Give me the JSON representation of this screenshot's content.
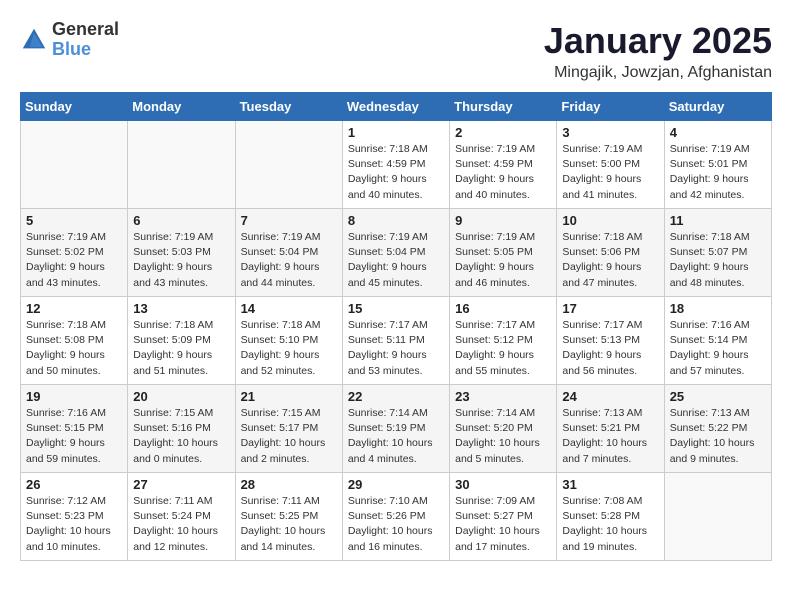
{
  "logo": {
    "general": "General",
    "blue": "Blue"
  },
  "title": "January 2025",
  "subtitle": "Mingajik, Jowzjan, Afghanistan",
  "weekdays": [
    "Sunday",
    "Monday",
    "Tuesday",
    "Wednesday",
    "Thursday",
    "Friday",
    "Saturday"
  ],
  "weeks": [
    [
      {
        "day": "",
        "info": ""
      },
      {
        "day": "",
        "info": ""
      },
      {
        "day": "",
        "info": ""
      },
      {
        "day": "1",
        "info": "Sunrise: 7:18 AM\nSunset: 4:59 PM\nDaylight: 9 hours\nand 40 minutes."
      },
      {
        "day": "2",
        "info": "Sunrise: 7:19 AM\nSunset: 4:59 PM\nDaylight: 9 hours\nand 40 minutes."
      },
      {
        "day": "3",
        "info": "Sunrise: 7:19 AM\nSunset: 5:00 PM\nDaylight: 9 hours\nand 41 minutes."
      },
      {
        "day": "4",
        "info": "Sunrise: 7:19 AM\nSunset: 5:01 PM\nDaylight: 9 hours\nand 42 minutes."
      }
    ],
    [
      {
        "day": "5",
        "info": "Sunrise: 7:19 AM\nSunset: 5:02 PM\nDaylight: 9 hours\nand 43 minutes."
      },
      {
        "day": "6",
        "info": "Sunrise: 7:19 AM\nSunset: 5:03 PM\nDaylight: 9 hours\nand 43 minutes."
      },
      {
        "day": "7",
        "info": "Sunrise: 7:19 AM\nSunset: 5:04 PM\nDaylight: 9 hours\nand 44 minutes."
      },
      {
        "day": "8",
        "info": "Sunrise: 7:19 AM\nSunset: 5:04 PM\nDaylight: 9 hours\nand 45 minutes."
      },
      {
        "day": "9",
        "info": "Sunrise: 7:19 AM\nSunset: 5:05 PM\nDaylight: 9 hours\nand 46 minutes."
      },
      {
        "day": "10",
        "info": "Sunrise: 7:18 AM\nSunset: 5:06 PM\nDaylight: 9 hours\nand 47 minutes."
      },
      {
        "day": "11",
        "info": "Sunrise: 7:18 AM\nSunset: 5:07 PM\nDaylight: 9 hours\nand 48 minutes."
      }
    ],
    [
      {
        "day": "12",
        "info": "Sunrise: 7:18 AM\nSunset: 5:08 PM\nDaylight: 9 hours\nand 50 minutes."
      },
      {
        "day": "13",
        "info": "Sunrise: 7:18 AM\nSunset: 5:09 PM\nDaylight: 9 hours\nand 51 minutes."
      },
      {
        "day": "14",
        "info": "Sunrise: 7:18 AM\nSunset: 5:10 PM\nDaylight: 9 hours\nand 52 minutes."
      },
      {
        "day": "15",
        "info": "Sunrise: 7:17 AM\nSunset: 5:11 PM\nDaylight: 9 hours\nand 53 minutes."
      },
      {
        "day": "16",
        "info": "Sunrise: 7:17 AM\nSunset: 5:12 PM\nDaylight: 9 hours\nand 55 minutes."
      },
      {
        "day": "17",
        "info": "Sunrise: 7:17 AM\nSunset: 5:13 PM\nDaylight: 9 hours\nand 56 minutes."
      },
      {
        "day": "18",
        "info": "Sunrise: 7:16 AM\nSunset: 5:14 PM\nDaylight: 9 hours\nand 57 minutes."
      }
    ],
    [
      {
        "day": "19",
        "info": "Sunrise: 7:16 AM\nSunset: 5:15 PM\nDaylight: 9 hours\nand 59 minutes."
      },
      {
        "day": "20",
        "info": "Sunrise: 7:15 AM\nSunset: 5:16 PM\nDaylight: 10 hours\nand 0 minutes."
      },
      {
        "day": "21",
        "info": "Sunrise: 7:15 AM\nSunset: 5:17 PM\nDaylight: 10 hours\nand 2 minutes."
      },
      {
        "day": "22",
        "info": "Sunrise: 7:14 AM\nSunset: 5:19 PM\nDaylight: 10 hours\nand 4 minutes."
      },
      {
        "day": "23",
        "info": "Sunrise: 7:14 AM\nSunset: 5:20 PM\nDaylight: 10 hours\nand 5 minutes."
      },
      {
        "day": "24",
        "info": "Sunrise: 7:13 AM\nSunset: 5:21 PM\nDaylight: 10 hours\nand 7 minutes."
      },
      {
        "day": "25",
        "info": "Sunrise: 7:13 AM\nSunset: 5:22 PM\nDaylight: 10 hours\nand 9 minutes."
      }
    ],
    [
      {
        "day": "26",
        "info": "Sunrise: 7:12 AM\nSunset: 5:23 PM\nDaylight: 10 hours\nand 10 minutes."
      },
      {
        "day": "27",
        "info": "Sunrise: 7:11 AM\nSunset: 5:24 PM\nDaylight: 10 hours\nand 12 minutes."
      },
      {
        "day": "28",
        "info": "Sunrise: 7:11 AM\nSunset: 5:25 PM\nDaylight: 10 hours\nand 14 minutes."
      },
      {
        "day": "29",
        "info": "Sunrise: 7:10 AM\nSunset: 5:26 PM\nDaylight: 10 hours\nand 16 minutes."
      },
      {
        "day": "30",
        "info": "Sunrise: 7:09 AM\nSunset: 5:27 PM\nDaylight: 10 hours\nand 17 minutes."
      },
      {
        "day": "31",
        "info": "Sunrise: 7:08 AM\nSunset: 5:28 PM\nDaylight: 10 hours\nand 19 minutes."
      },
      {
        "day": "",
        "info": ""
      }
    ]
  ]
}
